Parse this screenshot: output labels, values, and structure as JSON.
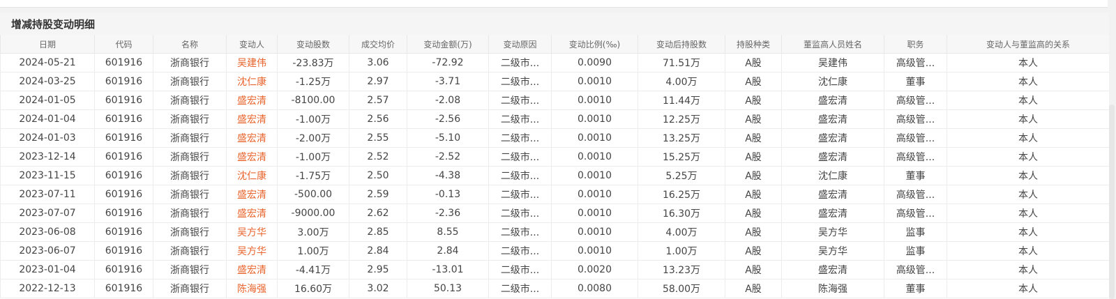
{
  "panel": {
    "title": "增减持股变动明细"
  },
  "table": {
    "headers": [
      "日期",
      "代码",
      "名称",
      "变动人",
      "变动股数",
      "成交均价",
      "变动金额(万)",
      "变动原因",
      "变动比例(‰)",
      "变动后持股数",
      "持股种类",
      "董监高人员姓名",
      "职务",
      "变动人与董监高的关系"
    ],
    "rows": [
      [
        "2024-05-21",
        "601916",
        "浙商银行",
        "吴建伟",
        "-23.83万",
        "3.06",
        "-72.92",
        "二级市...",
        "0.0090",
        "71.51万",
        "A股",
        "吴建伟",
        "高级管...",
        "本人"
      ],
      [
        "2024-03-25",
        "601916",
        "浙商银行",
        "沈仁康",
        "-1.25万",
        "2.97",
        "-3.71",
        "二级市...",
        "0.0010",
        "4.00万",
        "A股",
        "沈仁康",
        "董事",
        "本人"
      ],
      [
        "2024-01-05",
        "601916",
        "浙商银行",
        "盛宏清",
        "-8100.00",
        "2.57",
        "-2.08",
        "二级市...",
        "0.0010",
        "11.44万",
        "A股",
        "盛宏清",
        "高级管...",
        "本人"
      ],
      [
        "2024-01-04",
        "601916",
        "浙商银行",
        "盛宏清",
        "-1.00万",
        "2.56",
        "-2.56",
        "二级市...",
        "0.0010",
        "12.25万",
        "A股",
        "盛宏清",
        "高级管...",
        "本人"
      ],
      [
        "2024-01-03",
        "601916",
        "浙商银行",
        "盛宏清",
        "-2.00万",
        "2.55",
        "-5.10",
        "二级市...",
        "0.0010",
        "13.25万",
        "A股",
        "盛宏清",
        "高级管...",
        "本人"
      ],
      [
        "2023-12-14",
        "601916",
        "浙商银行",
        "盛宏清",
        "-1.00万",
        "2.52",
        "-2.52",
        "二级市...",
        "0.0010",
        "15.25万",
        "A股",
        "盛宏清",
        "高级管...",
        "本人"
      ],
      [
        "2023-11-15",
        "601916",
        "浙商银行",
        "沈仁康",
        "-1.75万",
        "2.50",
        "-4.38",
        "二级市...",
        "0.0010",
        "5.25万",
        "A股",
        "沈仁康",
        "董事",
        "本人"
      ],
      [
        "2023-07-11",
        "601916",
        "浙商银行",
        "盛宏清",
        "-500.00",
        "2.59",
        "-0.13",
        "二级市...",
        "0.0010",
        "16.25万",
        "A股",
        "盛宏清",
        "高级管...",
        "本人"
      ],
      [
        "2023-07-07",
        "601916",
        "浙商银行",
        "盛宏清",
        "-9000.00",
        "2.62",
        "-2.36",
        "二级市...",
        "0.0010",
        "16.30万",
        "A股",
        "盛宏清",
        "高级管...",
        "本人"
      ],
      [
        "2023-06-08",
        "601916",
        "浙商银行",
        "吴方华",
        "3.00万",
        "2.85",
        "8.55",
        "二级市...",
        "0.0010",
        "4.00万",
        "A股",
        "吴方华",
        "监事",
        "本人"
      ],
      [
        "2023-06-07",
        "601916",
        "浙商银行",
        "吴方华",
        "1.00万",
        "2.84",
        "2.84",
        "二级市...",
        "0.0010",
        "1.00万",
        "A股",
        "吴方华",
        "监事",
        "本人"
      ],
      [
        "2023-01-04",
        "601916",
        "浙商银行",
        "盛宏清",
        "-4.41万",
        "2.95",
        "-13.01",
        "二级市...",
        "0.0020",
        "13.23万",
        "A股",
        "盛宏清",
        "高级管...",
        "本人"
      ],
      [
        "2022-12-13",
        "601916",
        "浙商银行",
        "陈海强",
        "16.60万",
        "3.02",
        "50.13",
        "二级市...",
        "0.0080",
        "58.00万",
        "A股",
        "陈海强",
        "董事",
        "本人"
      ]
    ]
  },
  "colors": {
    "person_link": "#e8642c",
    "header_bg": "#f7f7f7",
    "panel_header_bg": "#f5f5f5"
  }
}
